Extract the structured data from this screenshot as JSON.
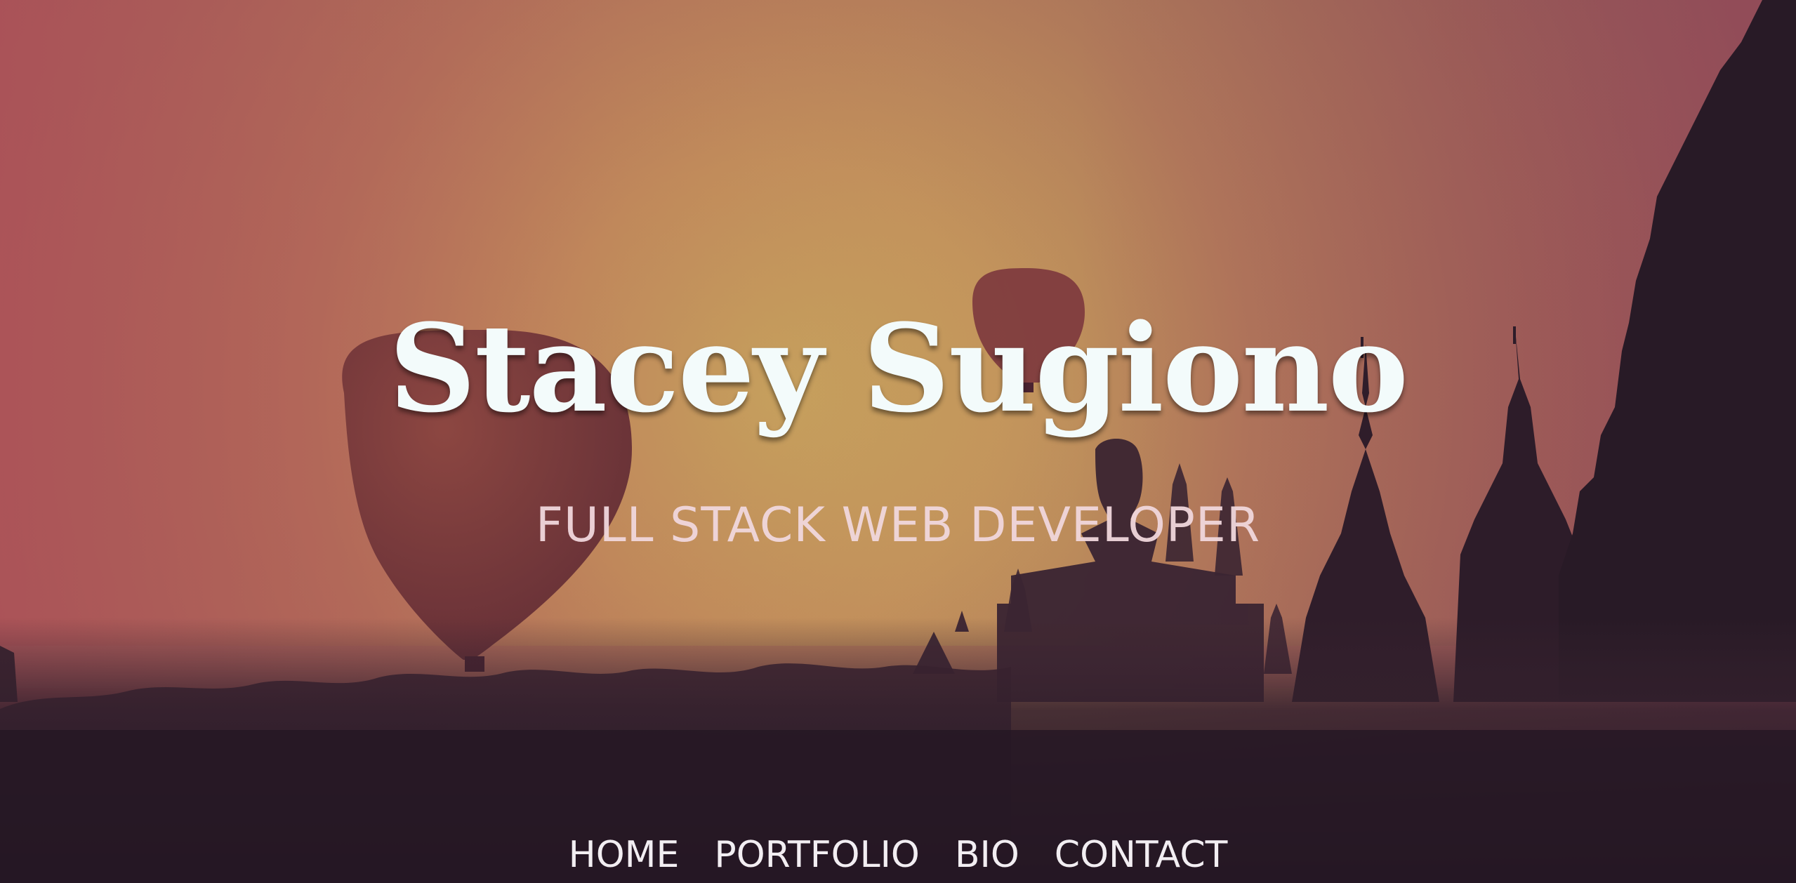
{
  "hero": {
    "title": "Stacey Sugiono",
    "subtitle": "FULL STACK WEB DEVELOPER"
  },
  "nav": {
    "items": [
      {
        "label": "HOME"
      },
      {
        "label": "PORTFOLIO"
      },
      {
        "label": "BIO"
      },
      {
        "label": "CONTACT"
      }
    ]
  },
  "background": {
    "scene": "sunset-hot-air-balloons-temples",
    "colors": {
      "sky_top": "#8c6456",
      "sky_glow": "#c9a35d",
      "sky_left": "#b85c58",
      "silhouette": "#2e1e2c",
      "balloon": "#7a3a3c"
    }
  }
}
